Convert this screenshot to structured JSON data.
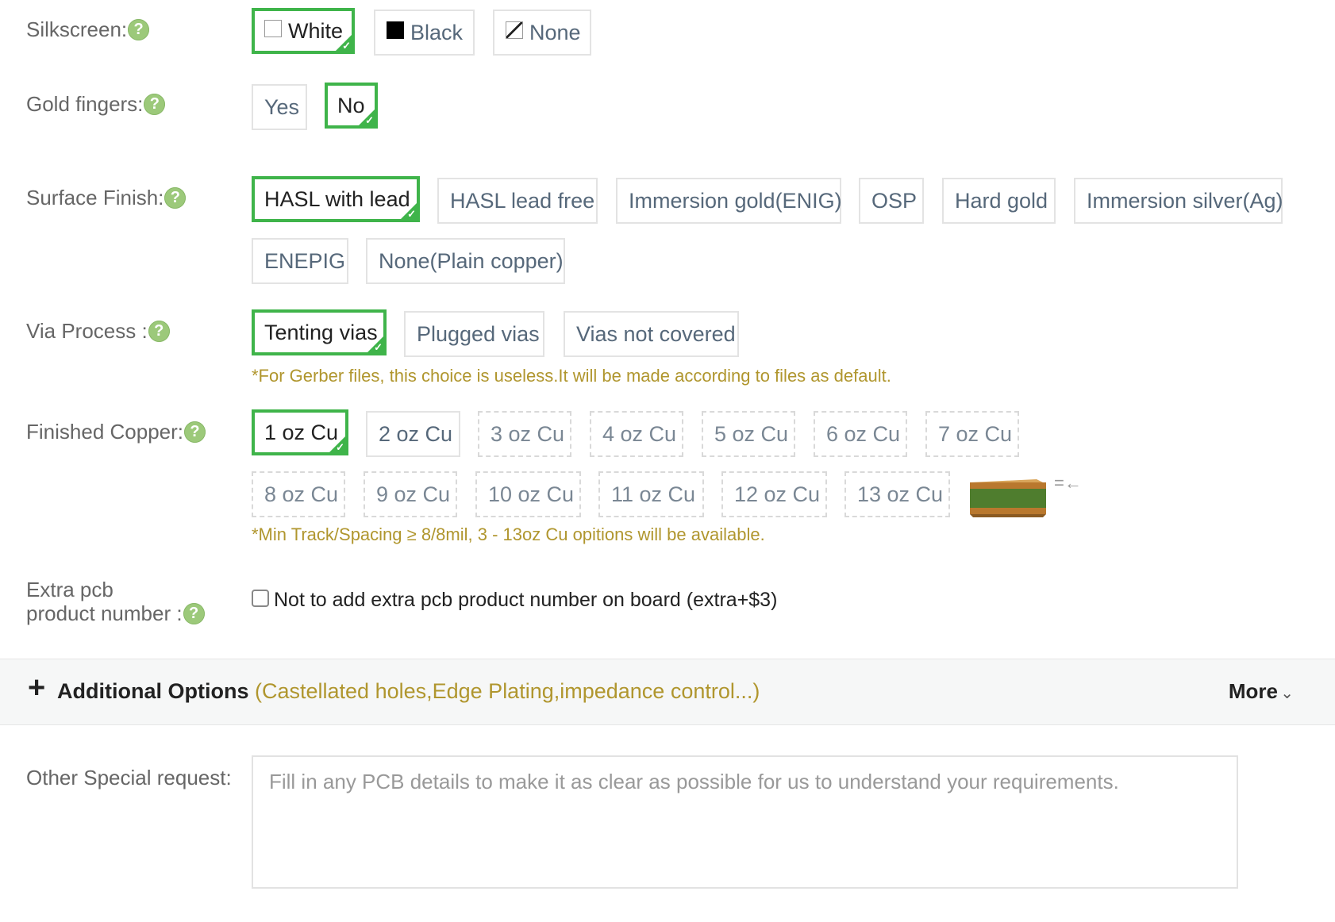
{
  "silkscreen": {
    "label": "Silkscreen:",
    "options": [
      "White",
      "Black",
      "None"
    ],
    "selected": "White"
  },
  "gold_fingers": {
    "label": "Gold fingers:",
    "options": [
      "Yes",
      "No"
    ],
    "selected": "No"
  },
  "surface_finish": {
    "label": "Surface Finish:",
    "options": [
      "HASL with lead",
      "HASL lead free",
      "Immersion gold(ENIG)",
      "OSP",
      "Hard gold",
      "Immersion silver(Ag)",
      "ENEPIG",
      "None(Plain copper)"
    ],
    "selected": "HASL with lead"
  },
  "via_process": {
    "label": "Via Process :",
    "options": [
      "Tenting vias",
      "Plugged vias",
      "Vias not covered"
    ],
    "selected": "Tenting vias",
    "note": "*For Gerber files, this choice is useless.It will be made according to files as default."
  },
  "finished_copper": {
    "label": "Finished Copper:",
    "options": [
      "1 oz Cu",
      "2 oz Cu",
      "3 oz Cu",
      "4 oz Cu",
      "5 oz Cu",
      "6 oz Cu",
      "7 oz Cu",
      "8 oz Cu",
      "9 oz Cu",
      "10 oz Cu",
      "11 oz Cu",
      "12 oz Cu",
      "13 oz Cu"
    ],
    "selected": "1 oz Cu",
    "note": "*Min Track/Spacing ≥ 8/8mil, 3 - 13oz Cu opitions will be available."
  },
  "extra_pcb": {
    "label_line1": "Extra pcb",
    "label_line2": "product number :",
    "checkbox_text": "Not to add extra pcb product number on board (extra+$3)"
  },
  "additional_options": {
    "title": "Additional Options",
    "subtitle": "(Castellated holes,Edge Plating,impedance control...)",
    "more": "More"
  },
  "special_request": {
    "label": "Other Special request:",
    "placeholder": "Fill in any PCB details to make it as clear as possible for us to understand your requirements."
  },
  "help_glyph": "?",
  "check_glyph": "✓",
  "colors": {
    "selected_border": "#3fb44a",
    "note_text": "#b0962e",
    "help_icon": "#9cc97a"
  }
}
